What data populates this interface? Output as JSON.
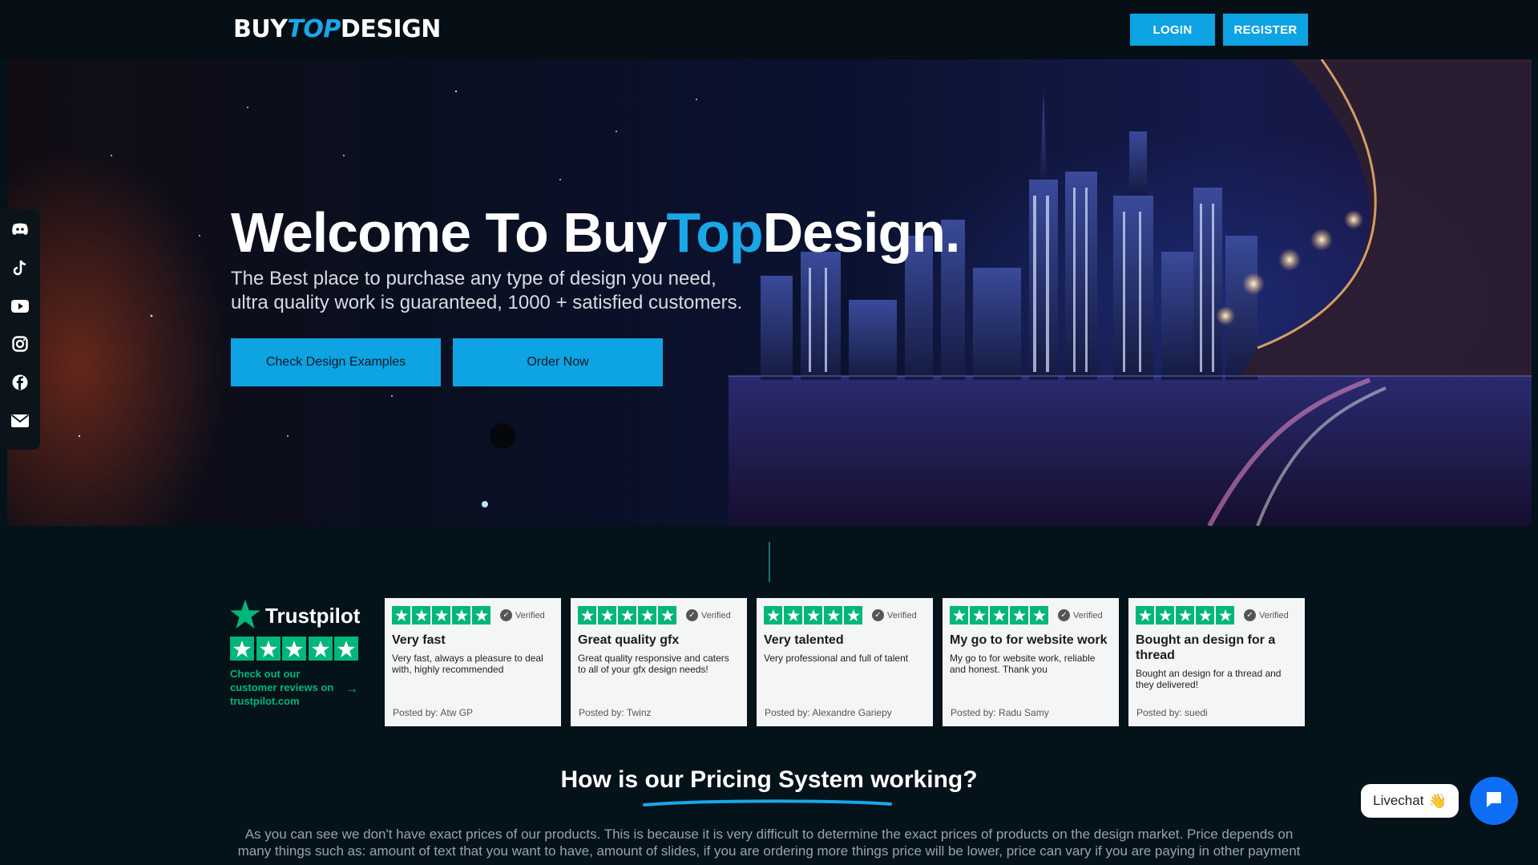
{
  "brand": {
    "logo_part1": "BUY",
    "logo_part2": "TOP",
    "logo_part3": "DESIGN",
    "accent_color": "#0ea3e2"
  },
  "header": {
    "login_label": "LOGIN",
    "register_label": "REGISTER"
  },
  "hero": {
    "title_part1": "Welcome To Buy",
    "title_accent": "Top",
    "title_part2": "Design.",
    "subtitle_line1": "The Best place to purchase any type of design you need,",
    "subtitle_line2": "ultra quality work is guaranteed, 1000 + satisfied customers.",
    "primary_button": "Check Design Examples",
    "secondary_button": "Order Now"
  },
  "social": {
    "icons": [
      "discord-icon",
      "tiktok-icon",
      "youtube-icon",
      "instagram-icon",
      "facebook-icon",
      "email-icon"
    ]
  },
  "trustpilot": {
    "name": "Trustpilot",
    "rating_stars": 5,
    "link_text": "Check out our customer reviews on trustpilot.com",
    "star_color": "#00b67a"
  },
  "reviews": [
    {
      "verified": "Verified",
      "title": "Very fast",
      "body": "Very fast, always a pleasure to deal with, highly recommended",
      "posted_by": "Posted by: Atw GP"
    },
    {
      "verified": "Verified",
      "title": "Great quality gfx",
      "body": "Great quality responsive and caters to all of your gfx design needs!",
      "posted_by": "Posted by: Twinz"
    },
    {
      "verified": "Verified",
      "title": "Very talented",
      "body": "Very professional and full of talent",
      "posted_by": "Posted by: Alexandre Gariepy"
    },
    {
      "verified": "Verified",
      "title": "My go to for website work",
      "body": "My go to for website work, reliable and honest. Thank you",
      "posted_by": "Posted by: Radu Samy"
    },
    {
      "verified": "Verified",
      "title": "Bought an design for a thread",
      "body": "Bought an design for a thread and they delivered!",
      "posted_by": "Posted by: suedi"
    }
  ],
  "pricing": {
    "title": "How is our Pricing System working?",
    "text": "As you can see we don't have exact prices of our products. This is because it is very difficult to determine the exact prices of products on the design market. Price depends on many things such as: amount of text that you want to have, amount of slides, if you are ordering more things price will be lower, price can vary if you are paying in other payment"
  },
  "livechat": {
    "label": "Livechat",
    "emoji": "👋"
  }
}
